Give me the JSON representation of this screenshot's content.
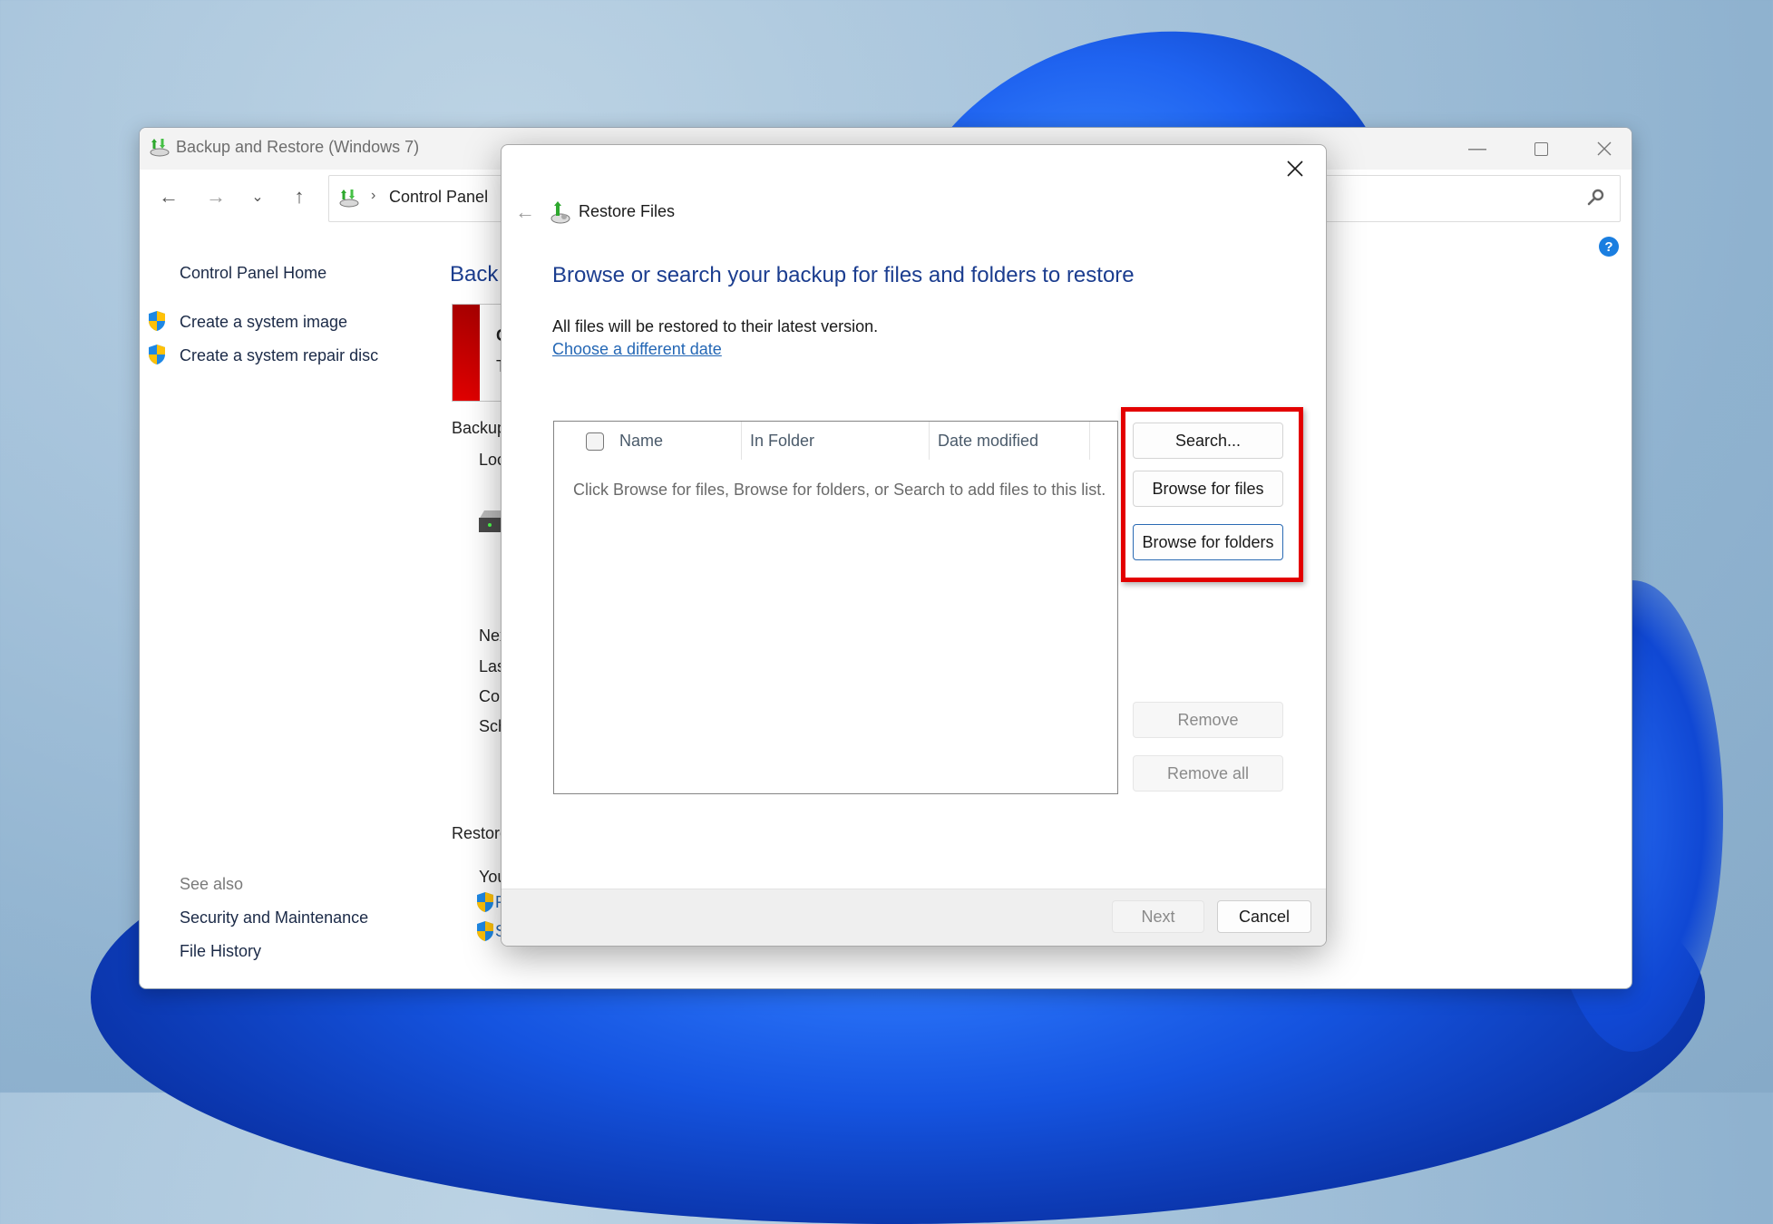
{
  "main_window": {
    "title": "Backup and Restore (Windows 7)",
    "controls": {
      "minimize_icon": "minimize-icon",
      "maximize_icon": "maximize-icon",
      "close_icon": "close-icon"
    },
    "nav": {
      "back_glyph": "←",
      "forward_glyph": "→",
      "recent_glyph": "⌄",
      "up_glyph": "↑",
      "breadcrumb_sep": "›",
      "breadcrumb": [
        "Control Panel"
      ],
      "breadcrumb_trailing_sep": "›"
    },
    "help_glyph": "?",
    "left_pane": {
      "home_link": "Control Panel Home",
      "tasks": [
        {
          "label": "Create a system image",
          "icon": "uac-shield-icon"
        },
        {
          "label": "Create a system repair disc",
          "icon": "uac-shield-icon"
        }
      ],
      "see_also_label": "See also",
      "see_also_links": [
        "Security and Maintenance",
        "File History"
      ]
    },
    "content_pane": {
      "heading_partial": "Back u",
      "alert_title_partial": "C",
      "alert_text_partial": "Th",
      "backup_section_partial": "Backup",
      "location_partial": "Loca",
      "next_partial": "Nex",
      "last_partial": "Last",
      "contents_partial": "Con",
      "schedule_partial": "Sche",
      "restore_section_partial": "Restore",
      "you_partial": "You",
      "restore_link1_partial": "R",
      "restore_link2_partial": "S"
    }
  },
  "dialog": {
    "title": "Restore Files",
    "back_glyph": "←",
    "heading": "Browse or search your backup for files and folders to restore",
    "info_text": "All files will be restored to their latest version.",
    "choose_date_link": "Choose a different date",
    "file_list": {
      "columns": [
        "Name",
        "In Folder",
        "Date modified"
      ],
      "select_all_checked": false,
      "empty_message": "Click Browse for files, Browse for folders, or Search to add files to this list."
    },
    "buttons": {
      "search": "Search...",
      "browse_files": "Browse for files",
      "browse_folders": "Browse for folders",
      "remove": "Remove",
      "remove_all": "Remove all"
    },
    "footer": {
      "next": "Next",
      "cancel": "Cancel"
    },
    "highlight_color": "#e30000"
  }
}
